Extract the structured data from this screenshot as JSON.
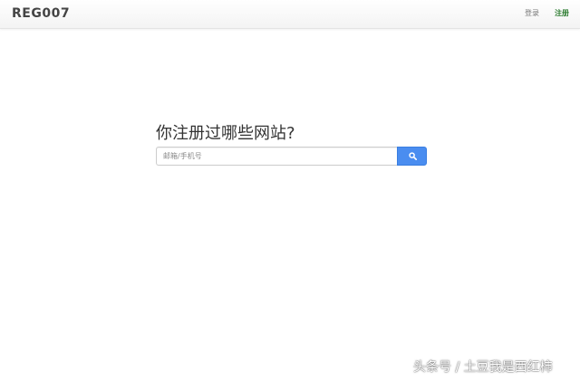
{
  "header": {
    "logo_text": "REG007",
    "login_label": "登录",
    "register_label": "注册"
  },
  "hero": {
    "title": "你注册过哪些网站?"
  },
  "search": {
    "value": "",
    "placeholder": "邮箱/手机号",
    "button_icon": "search-icon"
  },
  "watermark": {
    "text": "头条号 / 土豆我是西红柿"
  },
  "colors": {
    "accent_button": "#4a8df0",
    "register_link": "#2e7d32",
    "logo": "#444444"
  }
}
